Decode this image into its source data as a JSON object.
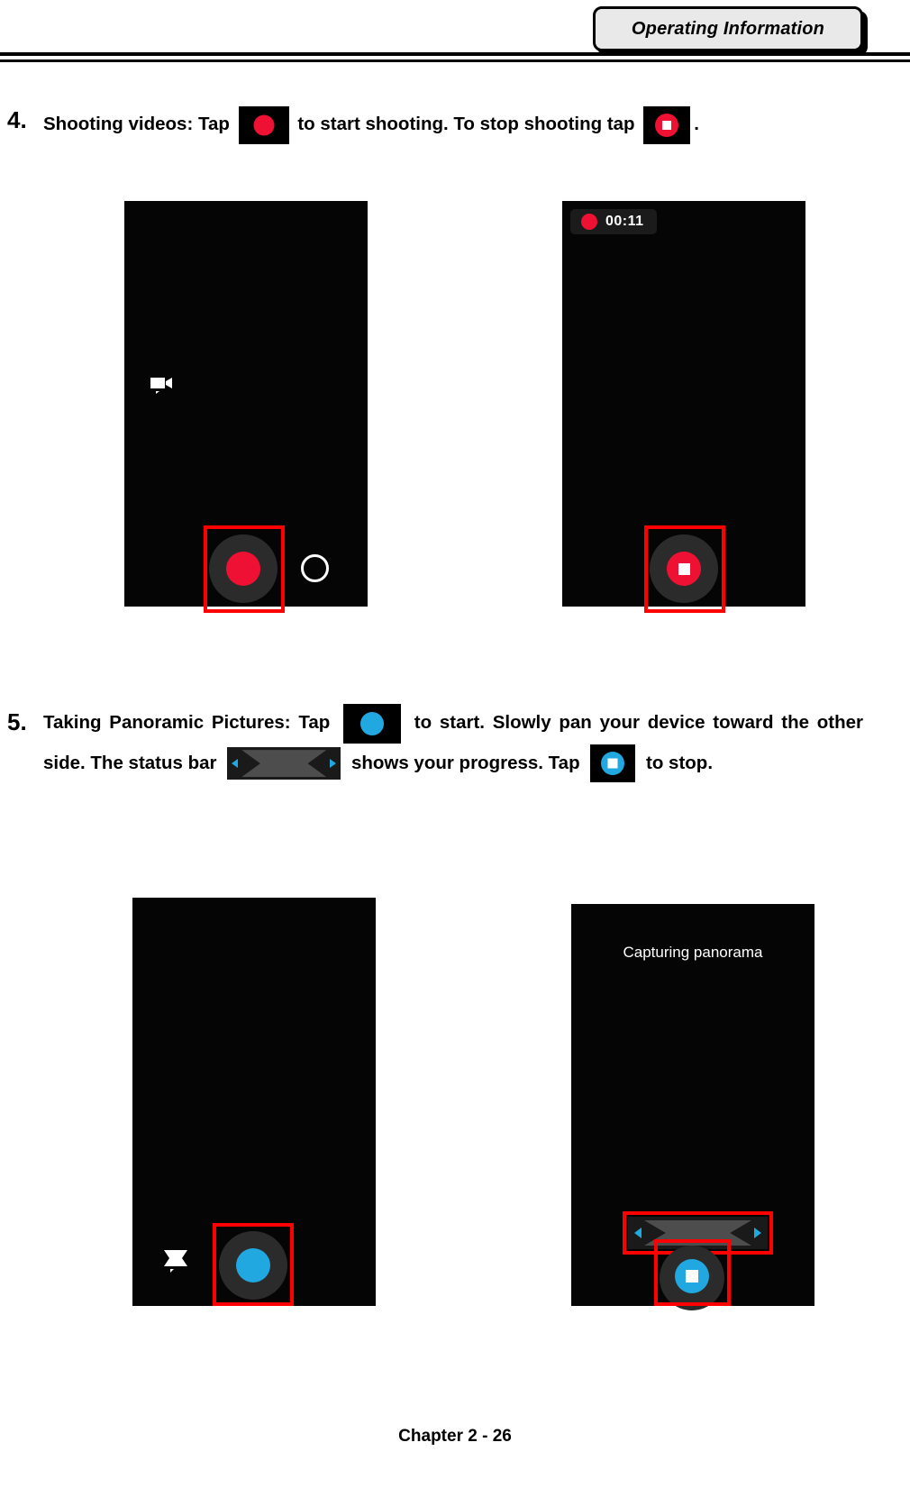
{
  "header": {
    "tab_label": "Operating Information"
  },
  "footer": {
    "text": "Chapter 2 - 26"
  },
  "items": [
    {
      "number": "4.",
      "text_part1": "Shooting videos: Tap",
      "text_part2": "to start shooting. To stop shooting tap",
      "text_part3": "."
    },
    {
      "number": "5.",
      "text_part1": "Taking Panoramic Pictures: Tap",
      "text_part2": "to start. Slowly pan your device toward the other side. The status bar",
      "text_part3": "shows your progress. Tap",
      "text_part4": "to stop."
    }
  ],
  "figures": {
    "video_start": {
      "name": "video-record-start-screen",
      "mode_icon": "video-camera-icon"
    },
    "video_recording": {
      "name": "video-recording-screen",
      "rec_time": "00:11"
    },
    "pano_start": {
      "name": "panorama-start-screen",
      "mode_icon": "panorama-icon"
    },
    "pano_capturing": {
      "name": "panorama-capturing-screen",
      "caption": "Capturing panorama"
    }
  },
  "colors": {
    "record_red": "#ee1133",
    "panorama_blue": "#21a8e0",
    "highlight_box": "#ff0000",
    "screen_black": "#050505"
  }
}
